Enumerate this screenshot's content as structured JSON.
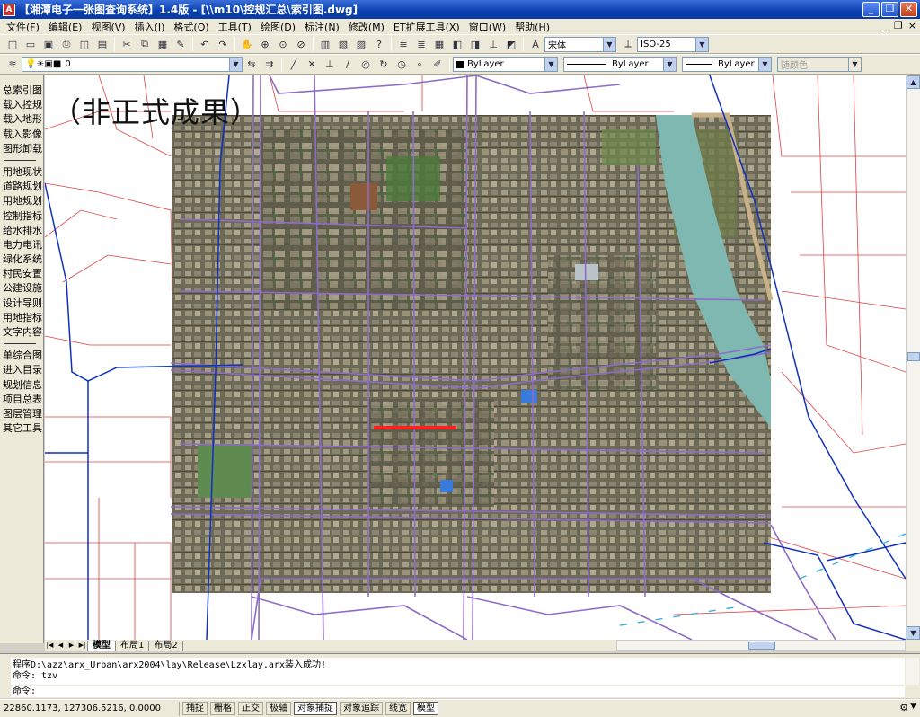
{
  "titlebar": {
    "title": "【湘潭电子一张图查询系统】1.4版 - [\\\\m10\\控规汇总\\索引图.dwg]",
    "minimize": "_",
    "maximize": "❐",
    "close": "✕"
  },
  "menu": {
    "items": [
      "文件(F)",
      "编辑(E)",
      "视图(V)",
      "插入(I)",
      "格式(O)",
      "工具(T)",
      "绘图(D)",
      "标注(N)",
      "修改(M)",
      "ET扩展工具(X)",
      "窗口(W)",
      "帮助(H)"
    ],
    "doc_min": "_",
    "doc_restore": "❐",
    "doc_close": "×"
  },
  "toolbar1": {
    "font_value": "宋体",
    "dimstyle_value": "ISO-25"
  },
  "toolbar2": {
    "layer_value": "0",
    "color_value": "ByLayer",
    "linetype_value": "ByLayer",
    "lineweight_value": "ByLayer",
    "plotstyle_value": "随颜色"
  },
  "left_panel": {
    "group1": [
      "总索引图",
      "载入控规",
      "载入地形",
      "载入影像",
      "图形卸载"
    ],
    "group2": [
      "用地现状",
      "道路规划",
      "用地规划",
      "控制指标",
      "给水排水",
      "电力电讯",
      "绿化系统",
      "村民安置",
      "公建设施",
      "设计导则",
      "用地指标",
      "文字内容"
    ],
    "group3": [
      "单综合图",
      "进入目录",
      "规划信息",
      "项目总表",
      "图层管理",
      "其它工具"
    ]
  },
  "drawing": {
    "watermark": "（非正式成果）"
  },
  "tabs": {
    "items": [
      "模型",
      "布局1",
      "布局2"
    ],
    "active": 0
  },
  "command": {
    "line1": "程序D:\\azz\\arx_Urban\\arx2004\\lay\\Release\\Lzxlay.arx装入成功!",
    "line2": "命令: tzv",
    "prompt": "命令:"
  },
  "status": {
    "coords": "22860.1173, 127306.5216, 0.0000",
    "buttons": [
      {
        "label": "捕捉",
        "on": false
      },
      {
        "label": "栅格",
        "on": false
      },
      {
        "label": "正交",
        "on": false
      },
      {
        "label": "极轴",
        "on": false
      },
      {
        "label": "对象捕捉",
        "on": true
      },
      {
        "label": "对象追踪",
        "on": false
      },
      {
        "label": "线宽",
        "on": false
      },
      {
        "label": "模型",
        "on": true
      }
    ]
  },
  "colors": {
    "titlebar": "#0a3fb0",
    "road_purple": "#8c6cc8",
    "parcel_red": "#e04040",
    "boundary_blue": "#1030c0",
    "river": "#7fb8b0"
  }
}
